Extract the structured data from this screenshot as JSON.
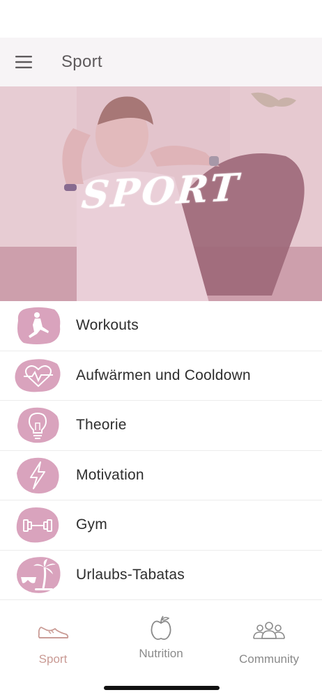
{
  "header": {
    "title": "Sport",
    "menu_icon": "hamburger-menu-icon"
  },
  "hero": {
    "title": "SPORT",
    "tint": "#d9a9b7"
  },
  "menu": {
    "items": [
      {
        "label": "Workouts",
        "icon": "lunge-figure-icon"
      },
      {
        "label": "Aufwärmen und Cooldown",
        "icon": "heartbeat-icon"
      },
      {
        "label": "Theorie",
        "icon": "lightbulb-icon"
      },
      {
        "label": "Motivation",
        "icon": "lightning-icon"
      },
      {
        "label": "Gym",
        "icon": "dumbbell-icon"
      },
      {
        "label": "Urlaubs-Tabatas",
        "icon": "palm-sunglasses-icon"
      }
    ]
  },
  "tabs": {
    "sport": {
      "label": "Sport",
      "icon": "sneaker-icon",
      "active": true
    },
    "nutrition": {
      "label": "Nutrition",
      "icon": "apple-icon",
      "active": false
    },
    "community": {
      "label": "Community",
      "icon": "people-group-icon",
      "active": false
    }
  },
  "colors": {
    "accent": "#c99a94",
    "icon_blob": "#d9a3bd",
    "inactive": "#8a8a8a"
  }
}
